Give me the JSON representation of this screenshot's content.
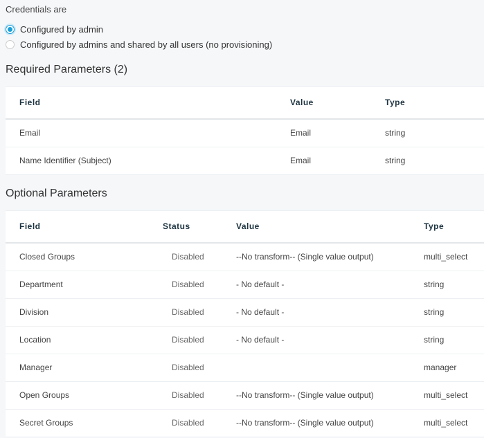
{
  "credentials": {
    "label": "Credentials are",
    "options": [
      {
        "label": "Configured by admin",
        "selected": true
      },
      {
        "label": "Configured by admins and shared by all users (no provisioning)",
        "selected": false
      }
    ],
    "accent_color": "#1a9fd9"
  },
  "required": {
    "title": "Required Parameters (2)",
    "columns": [
      "Field",
      "Value",
      "Type"
    ],
    "rows": [
      [
        "Email",
        "Email",
        "string"
      ],
      [
        "Name Identifier (Subject)",
        "Email",
        "string"
      ]
    ]
  },
  "optional": {
    "title": "Optional Parameters",
    "columns": [
      "Field",
      "Status",
      "Value",
      "Type"
    ],
    "rows": [
      [
        "Closed Groups",
        "Disabled",
        "--No transform-- (Single value output)",
        "multi_select"
      ],
      [
        "Department",
        "Disabled",
        "- No default -",
        "string"
      ],
      [
        "Division",
        "Disabled",
        "- No default -",
        "string"
      ],
      [
        "Location",
        "Disabled",
        "- No default -",
        "string"
      ],
      [
        "Manager",
        "Disabled",
        "",
        "manager"
      ],
      [
        "Open Groups",
        "Disabled",
        "--No transform-- (Single value output)",
        "multi_select"
      ],
      [
        "Secret Groups",
        "Disabled",
        "--No transform-- (Single value output)",
        "multi_select"
      ]
    ]
  }
}
